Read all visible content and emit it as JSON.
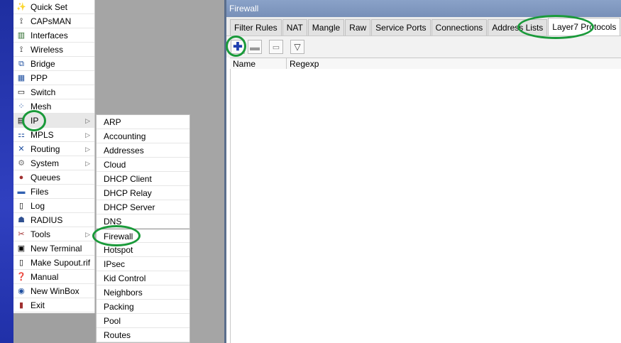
{
  "main_menu": [
    {
      "label": "Quick Set",
      "icon": "wand-icon"
    },
    {
      "label": "CAPsMAN",
      "icon": "antenna-icon"
    },
    {
      "label": "Interfaces",
      "icon": "interfaces-icon"
    },
    {
      "label": "Wireless",
      "icon": "wireless-icon"
    },
    {
      "label": "Bridge",
      "icon": "bridge-icon"
    },
    {
      "label": "PPP",
      "icon": "ppp-icon"
    },
    {
      "label": "Switch",
      "icon": "switch-icon"
    },
    {
      "label": "Mesh",
      "icon": "mesh-icon"
    },
    {
      "label": "IP",
      "icon": "ip-icon",
      "arrow": "▷"
    },
    {
      "label": "MPLS",
      "icon": "mpls-icon",
      "arrow": "▷"
    },
    {
      "label": "Routing",
      "icon": "routing-icon",
      "arrow": "▷"
    },
    {
      "label": "System",
      "icon": "gear-icon",
      "arrow": "▷"
    },
    {
      "label": "Queues",
      "icon": "queues-icon"
    },
    {
      "label": "Files",
      "icon": "folder-icon"
    },
    {
      "label": "Log",
      "icon": "log-icon"
    },
    {
      "label": "RADIUS",
      "icon": "radius-icon"
    },
    {
      "label": "Tools",
      "icon": "tools-icon",
      "arrow": "▷"
    },
    {
      "label": "New Terminal",
      "icon": "terminal-icon"
    },
    {
      "label": "Make Supout.rif",
      "icon": "document-icon"
    },
    {
      "label": "Manual",
      "icon": "help-icon"
    },
    {
      "label": "New WinBox",
      "icon": "winbox-icon"
    },
    {
      "label": "Exit",
      "icon": "exit-icon"
    }
  ],
  "ip_submenu": [
    "ARP",
    "Accounting",
    "Addresses",
    "Cloud",
    "DHCP Client",
    "DHCP Relay",
    "DHCP Server",
    "DNS",
    "Firewall",
    "Hotspot",
    "IPsec",
    "Kid Control",
    "Neighbors",
    "Packing",
    "Pool",
    "Routes"
  ],
  "window": {
    "title": "Firewall",
    "tabs": [
      "Filter Rules",
      "NAT",
      "Mangle",
      "Raw",
      "Service Ports",
      "Connections",
      "Address Lists",
      "Layer7 Protocols"
    ],
    "active_tab": "Layer7 Protocols",
    "columns": [
      "Name",
      "Regexp"
    ]
  },
  "colors": {
    "highlight_oval": "#1a9a3a",
    "title_bar": "#7d95bd",
    "side_bar": "#2a38b0"
  }
}
